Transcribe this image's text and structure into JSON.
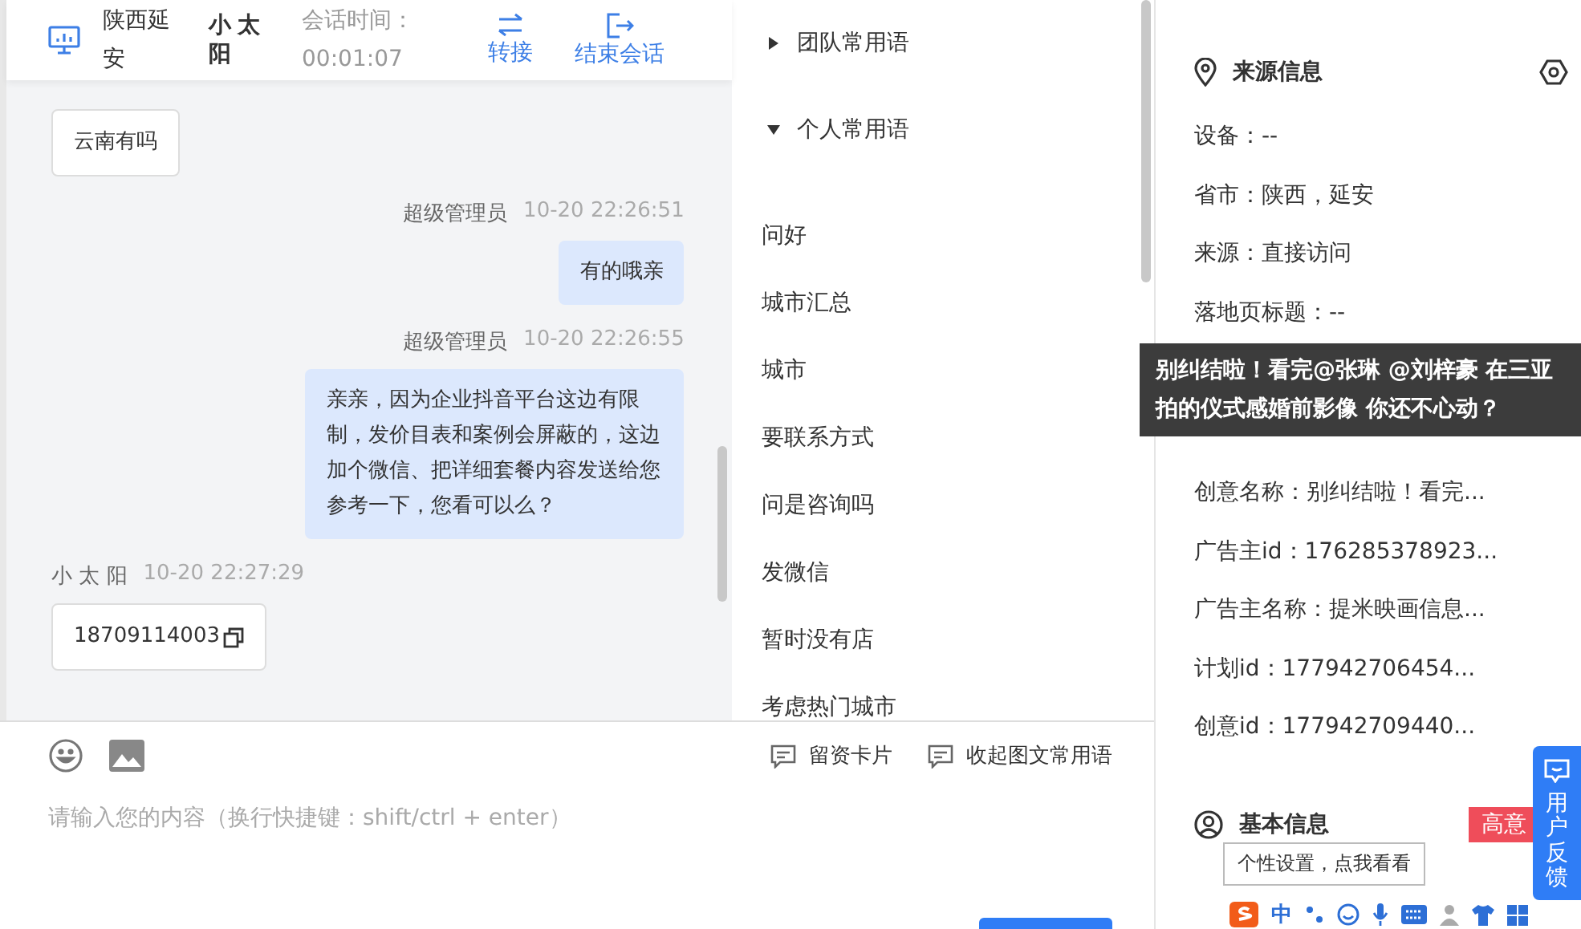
{
  "header": {
    "location": "陕西延安",
    "customer": "小太阳",
    "duration_label": "会话时间：",
    "duration": "00:01:07",
    "actions": [
      {
        "kind": "transfer",
        "label": "转接"
      },
      {
        "kind": "end",
        "label": "结束会话"
      }
    ]
  },
  "messages": [
    {
      "kind": "customer",
      "text": "云南有吗",
      "copyable": false
    },
    {
      "kind": "agent",
      "sender": "超级管理员",
      "time": "10-20 22:26:51",
      "text": "有的哦亲",
      "copyable": false
    },
    {
      "kind": "agent",
      "sender": "超级管理员",
      "time": "10-20 22:26:55",
      "text": "亲亲，因为企业抖音平台这边有限制，发价目表和案例会屏蔽的，这边加个微信、把详细套餐内容发送给您参考一下，您看可以么？",
      "copyable": false
    },
    {
      "kind": "customer",
      "sender": "小 太 阳",
      "time": "10-20 22:27:29",
      "text": "18709114003",
      "copyable": true
    }
  ],
  "phrases": {
    "groups": [
      {
        "title": "团队常用语",
        "expanded": false
      },
      {
        "title": "个人常用语",
        "expanded": true,
        "items": [
          "问好",
          "城市汇总",
          "城市",
          "要联系方式",
          "问是咨询吗",
          "发微信",
          "暂时没有店",
          "考虑热门城市"
        ]
      }
    ]
  },
  "composer": {
    "tools": [
      {
        "label": "留资卡片"
      },
      {
        "label": "收起图文常用语"
      }
    ],
    "placeholder": "请输入您的内容（换行快捷键：shift/ctrl + enter）"
  },
  "source_info": {
    "title": "来源信息",
    "rows_before": [
      "设备：--",
      "省市：陕西，延安",
      "来源：直接访问",
      "落地页标题：--"
    ],
    "tooltip": "别纠结啦！看完@张琳 @刘梓豪 在三亚拍的仪式感婚前影像 你还不心动？",
    "rows_after": [
      "创意名称：别纠结啦！看完...",
      "广告主id：176285378923...",
      "广告主名称：提米映画信息...",
      "计划id：177942706454...",
      "创意id：177942709440..."
    ]
  },
  "basic_info": {
    "title": "基本信息",
    "badge": "高意"
  },
  "feedback": {
    "label": "用户反馈"
  },
  "ime": {
    "tip": "个性设置，点我看看",
    "mode": "中"
  }
}
